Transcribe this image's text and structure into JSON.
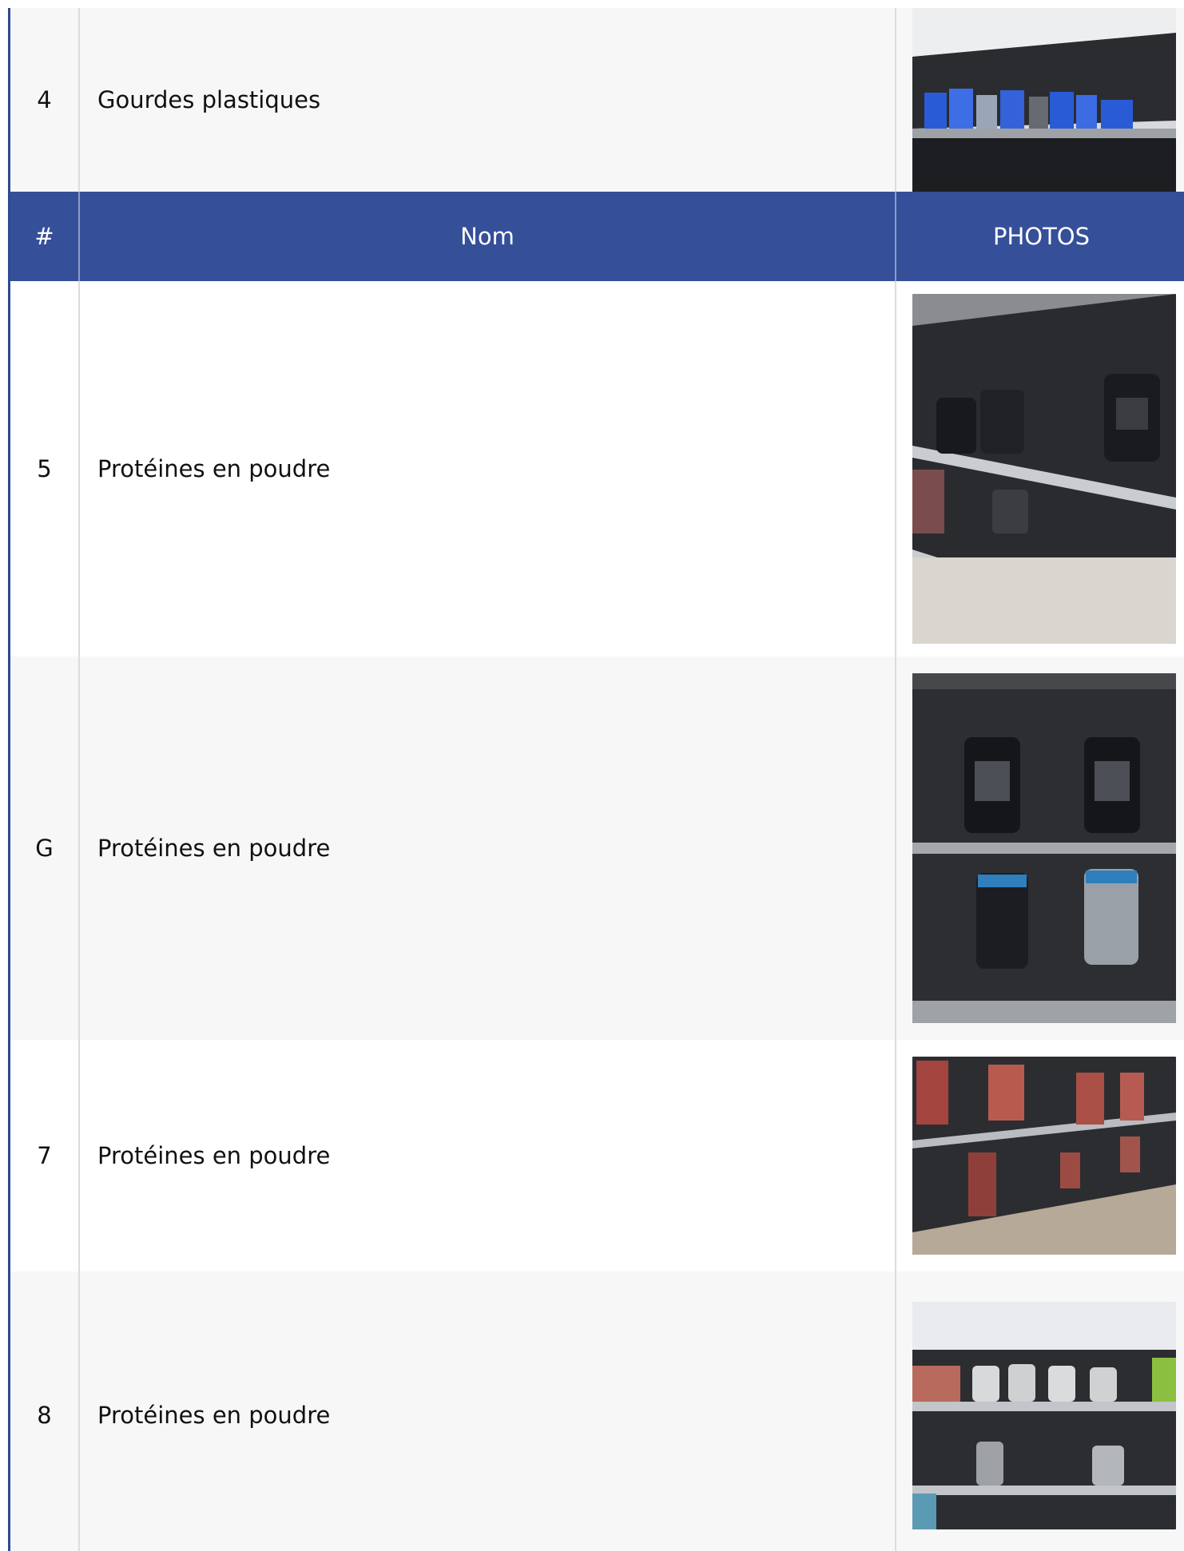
{
  "table": {
    "header": {
      "num": "#",
      "name": "Nom",
      "photos": "PHOTOS"
    },
    "rows": [
      {
        "num": "4",
        "name": "Gourdes plastiques",
        "photo_icon": "shelf-bottles-photo"
      },
      {
        "num": "5",
        "name": "Protéines en poudre",
        "photo_icon": "shelf-protein-tubs-photo"
      },
      {
        "num": "G",
        "name": "Protéines en poudre",
        "photo_icon": "shelf-protein-tubs-photo"
      },
      {
        "num": "7",
        "name": "Protéines en poudre",
        "photo_icon": "shelf-protein-bags-photo"
      },
      {
        "num": "8",
        "name": "Protéines en poudre",
        "photo_icon": "shelf-protein-mixed-photo"
      }
    ]
  },
  "colors": {
    "header_bg": "#354f99",
    "header_text": "#ffffff",
    "row_gray": "#f7f7f7",
    "row_white": "#ffffff",
    "left_border": "#2f4a92"
  }
}
